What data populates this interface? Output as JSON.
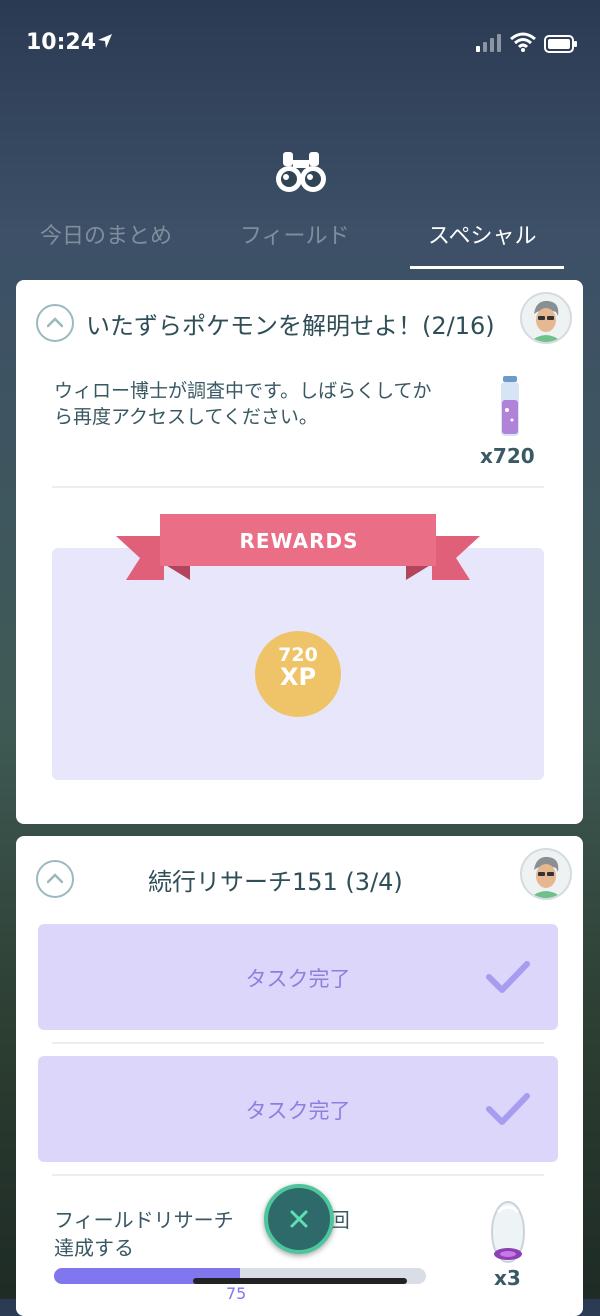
{
  "status_bar": {
    "time": "10:24",
    "icons": [
      "location-arrow-icon",
      "cellular-signal-icon",
      "wifi-icon",
      "battery-icon"
    ]
  },
  "header": {
    "icon": "binoculars-icon",
    "tabs": [
      {
        "label": "今日のまとめ",
        "active": false
      },
      {
        "label": "フィールド",
        "active": false
      },
      {
        "label": "スペシャル",
        "active": true
      }
    ]
  },
  "special_quest": {
    "title": "いたずらポケモンを解明せよ！(2/16)",
    "description": "ウィロー博士が調査中です。しばらくしてから再度アクセスしてください。",
    "reward_item": {
      "icon": "stardust-vial-icon",
      "count": "x720"
    },
    "rewards_label": "REWARDS",
    "xp_reward": {
      "amount": "720",
      "unit": "XP"
    }
  },
  "research_151": {
    "title": "続行リサーチ151 (3/4)",
    "tasks": [
      {
        "label": "タスク完了",
        "status": "completed"
      },
      {
        "label": "タスク完了",
        "status": "completed"
      }
    ],
    "current_task": {
      "text_start": "フィールドリサーチ",
      "text_end": "を151回",
      "text_line2": "達成する",
      "progress_value": "75",
      "progress_fraction": 0.5,
      "reward_icon": "incense-icon",
      "reward_count": "x3"
    }
  },
  "colors": {
    "accent_purple": "#8077ef",
    "ribbon_pink": "#ea6f86",
    "xp_gold": "#efc367",
    "close_green": "#4fc59e"
  }
}
